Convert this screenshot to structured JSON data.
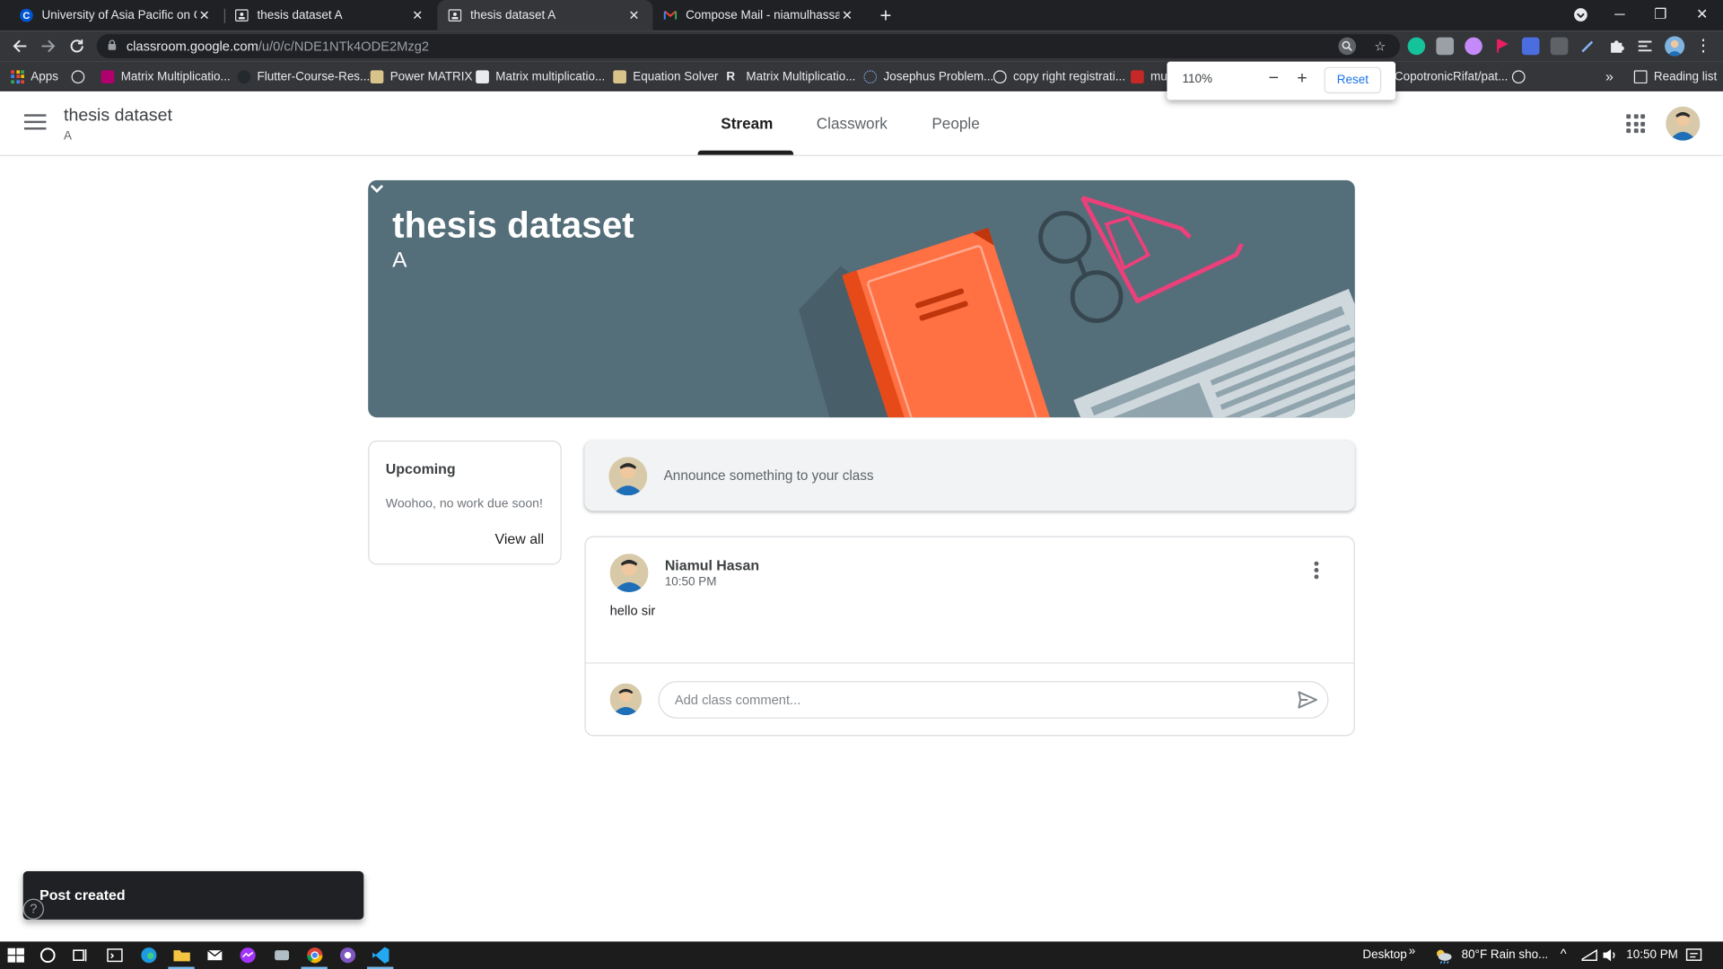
{
  "browser": {
    "tabs": [
      {
        "title": "University of Asia Pacific on Cour",
        "favicon": "coursera-icon",
        "active": false
      },
      {
        "title": "thesis dataset A",
        "favicon": "classroom-icon",
        "active": false
      },
      {
        "title": "thesis dataset A",
        "favicon": "classroom-icon",
        "active": true
      },
      {
        "title": "Compose Mail - niamulhassan64",
        "favicon": "gmail-icon",
        "active": false
      }
    ],
    "new_tab": "+",
    "url_host": "classroom.google.com",
    "url_path": "/u/0/c/NDE1NTk4ODE2Mzg2",
    "zoom": {
      "percent": "110%",
      "minus": "−",
      "plus": "+",
      "reset": "Reset"
    }
  },
  "bookmarks": {
    "apps": "Apps",
    "items": [
      "Matrix Multiplicatio...",
      "Flutter-Course-Res...",
      "Power MATRIX",
      "Matrix multiplicatio...",
      "Equation Solver",
      "Matrix Multiplicatio...",
      "Josephus Problem...",
      "copy right registrati...",
      "mu",
      "CopotronicRifat/pat..."
    ],
    "overflow": "»",
    "reading_list": "Reading list"
  },
  "classroom": {
    "class_name": "thesis dataset",
    "section": "A",
    "tabs": [
      "Stream",
      "Classwork",
      "People"
    ],
    "active_tab": "Stream",
    "banner": {
      "title": "thesis dataset",
      "section": "A"
    },
    "upcoming": {
      "title": "Upcoming",
      "empty": "Woohoo, no work due soon!",
      "view_all": "View all"
    },
    "announce_placeholder": "Announce something to your class",
    "post": {
      "author": "Niamul Hasan",
      "time": "10:50 PM",
      "body": "hello sir",
      "comment_placeholder": "Add class comment..."
    },
    "snackbar": "Post created",
    "help": "?"
  },
  "taskbar": {
    "desktop": "Desktop",
    "chevron": "»",
    "weather": "80°F  Rain sho...",
    "time": "10:50 PM"
  },
  "colors": {
    "banner": "#546e7a",
    "book": "#ff7043",
    "glasses": "#ec407a",
    "chrome_dark": "#202124",
    "chrome_toolbar": "#35363a",
    "link_blue": "#1a73e8"
  }
}
